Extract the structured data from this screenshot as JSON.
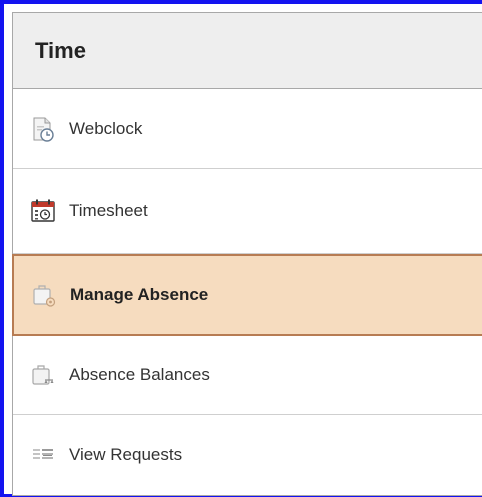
{
  "panel": {
    "title": "Time",
    "items": [
      {
        "label": "Webclock",
        "icon": "webclock-icon",
        "selected": false
      },
      {
        "label": "Timesheet",
        "icon": "calendar-clock-icon",
        "selected": false
      },
      {
        "label": "Manage Absence",
        "icon": "briefcase-gear-icon",
        "selected": true
      },
      {
        "label": "Absence Balances",
        "icon": "briefcase-scale-icon",
        "selected": false
      },
      {
        "label": "View Requests",
        "icon": "list-icon",
        "selected": false
      }
    ]
  },
  "colors": {
    "frame_border": "#1313f0",
    "header_bg": "#eeeeee",
    "selected_bg": "#f6dcbf",
    "selected_border": "#b77c53"
  }
}
